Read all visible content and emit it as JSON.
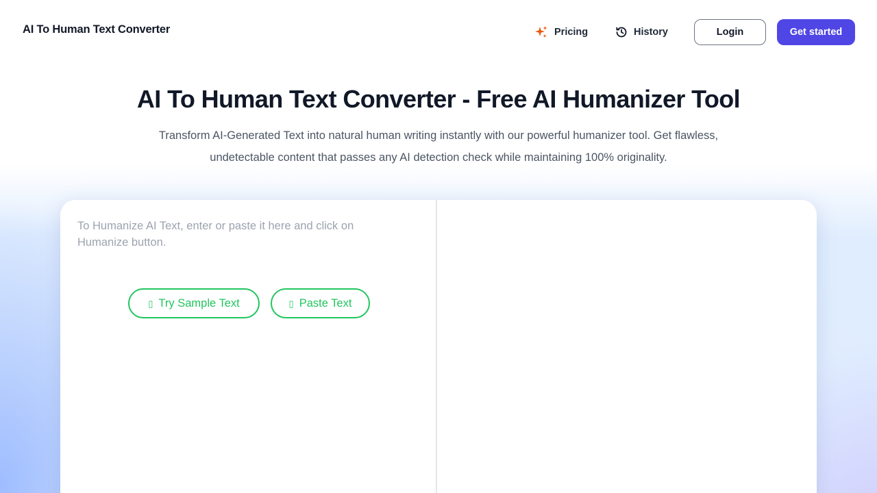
{
  "header": {
    "logo": "AI To Human Text Converter",
    "nav": {
      "pricing_label": "Pricing",
      "history_label": "History"
    },
    "login_label": "Login",
    "get_started_label": "Get started"
  },
  "hero": {
    "title": "AI To Human Text Converter - Free AI Humanizer Tool",
    "subtitle_line1": "Transform AI-Generated Text into natural human writing instantly with our powerful humanizer tool. Get flawless,",
    "subtitle_line2": "undetectable content that passes any AI detection check while maintaining 100% originality."
  },
  "editor": {
    "input_value": "",
    "input_placeholder": "To Humanize AI Text, enter or paste it here and click on Humanize button.",
    "try_sample_label": "Try Sample Text",
    "paste_label": "Paste Text",
    "output_value": ""
  },
  "icons": {
    "pricing": "sparkles-icon",
    "history": "history-icon",
    "try_sample": "sample-icon",
    "paste": "paste-icon"
  },
  "colors": {
    "accent": "#4f46e5",
    "pricing_icon": "#ea580c",
    "pill_green": "#22c55e",
    "title": "#111827",
    "subtitle": "#4b5563",
    "placeholder": "#9ca3af"
  }
}
